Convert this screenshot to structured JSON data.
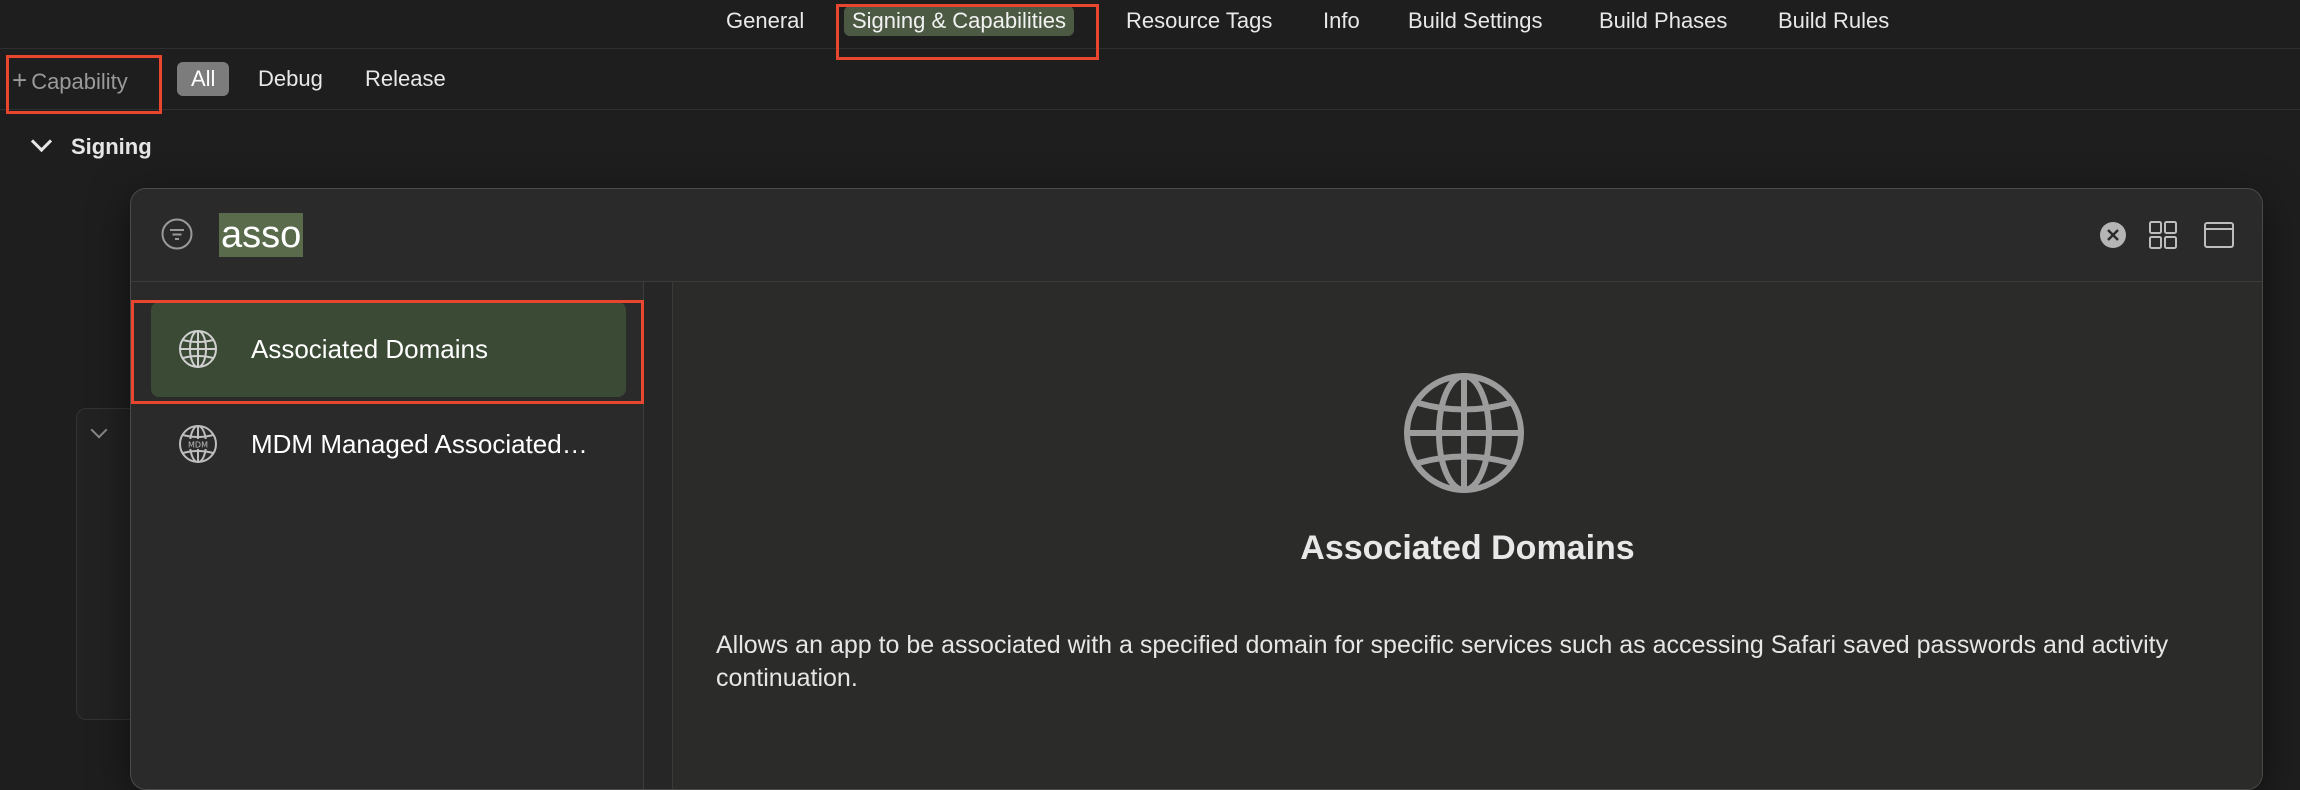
{
  "tabs": [
    {
      "label": "General"
    },
    {
      "label": "Signing & Capabilities"
    },
    {
      "label": "Resource Tags"
    },
    {
      "label": "Info"
    },
    {
      "label": "Build Settings"
    },
    {
      "label": "Build Phases"
    },
    {
      "label": "Build Rules"
    }
  ],
  "active_tab": "Signing & Capabilities",
  "toolbar": {
    "add_capability_label": "Capability",
    "filters": [
      {
        "label": "All"
      },
      {
        "label": "Debug"
      },
      {
        "label": "Release"
      }
    ],
    "selected_filter": "All"
  },
  "section": {
    "title": "Signing"
  },
  "library": {
    "search_value": "asso",
    "results": [
      {
        "label": "Associated Domains",
        "icon": "globe-icon"
      },
      {
        "label": "MDM Managed Associated…",
        "icon": "mdm-globe-icon"
      }
    ],
    "selected_result": "Associated Domains",
    "detail": {
      "title": "Associated Domains",
      "description": "Allows an app to be associated with a specified domain for specific services such as accessing Safari saved passwords and activity continuation.",
      "icon": "globe-icon"
    }
  },
  "colors": {
    "highlight_box": "#e8462e",
    "selected_item_bg": "#3b4a34",
    "active_tab_bg": "#4c5a43"
  }
}
